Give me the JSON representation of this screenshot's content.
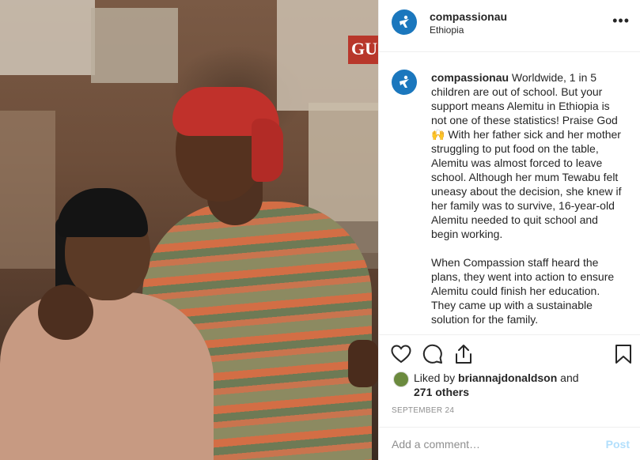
{
  "post": {
    "username": "compassionau",
    "location": "Ethiopia",
    "more_label": "•••",
    "poster_text": "GU"
  },
  "caption": {
    "username": "compassionau",
    "paragraph_1": " Worldwide, 1 in 5 children are out of school. But your support means Alemitu in Ethiopia is not one of these statistics! Praise God 🙌 With her father sick and her mother struggling to put food on the table, Alemitu was almost forced to leave school. Although her mum Tewabu felt uneasy about the decision, she knew if her family was to survive, 16-year-old Alemitu needed to quit school and begin working.",
    "paragraph_2": "When Compassion staff heard the plans, they went into action to ensure Alemitu could finish her education. They came up with a sustainable solution for the family."
  },
  "likes": {
    "prefix": "Liked by ",
    "user": "briannajdonaldson",
    "middle": " and",
    "others": "271 others"
  },
  "date": "SEPTEMBER 24",
  "comment": {
    "placeholder": "Add a comment…",
    "post_label": "Post"
  },
  "icons": {
    "like": "heart-icon",
    "comment": "comment-icon",
    "share": "share-icon",
    "save": "bookmark-icon",
    "avatar": "compassion-logo-icon"
  },
  "colors": {
    "brand_blue": "#1b77bd",
    "post_button_disabled": "#b2dffc",
    "muted_text": "#8e8e8e"
  }
}
